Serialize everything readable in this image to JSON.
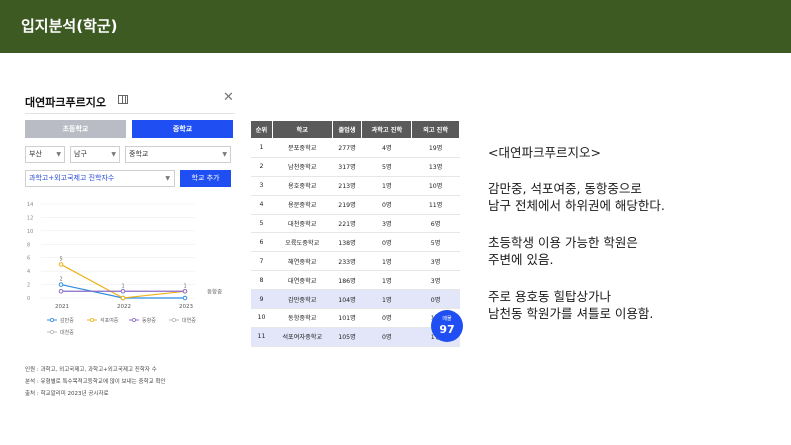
{
  "header": {
    "title": "입지분석(학군)"
  },
  "panel": {
    "title": "대연파크푸르지오",
    "tabs": [
      "초등학교",
      "중학교"
    ],
    "selects": [
      "부산",
      "남구",
      "중학교"
    ],
    "condition": "과학고+외고국제고 진학자수",
    "add_button": "학교 추가",
    "notes": [
      "인원 : 과학고, 외고국제고, 과학고+외고국제고 진학자 수",
      "분석 : 유형별로 특수목적고등학교에 많이 보내는 중학교 확인",
      "출처 : 학교알리미 2023년 공시자료"
    ]
  },
  "chart_data": {
    "type": "line",
    "x": [
      "2021",
      "2022",
      "2023"
    ],
    "ylim": [
      0,
      14
    ],
    "yticks": [
      0,
      2,
      4,
      6,
      8,
      10,
      12,
      14
    ],
    "series": [
      {
        "name": "감만중",
        "values": [
          2,
          0,
          0
        ],
        "color": "#2f8de4"
      },
      {
        "name": "석포여중",
        "values": [
          5,
          0,
          1
        ],
        "color": "#f0b21a"
      },
      {
        "name": "동항중",
        "values": [
          1,
          1,
          1
        ],
        "color": "#8a6bc9"
      },
      {
        "name": "대연중",
        "values": [
          null,
          null,
          null
        ],
        "color": "#b9b9b9"
      },
      {
        "name": "대천중",
        "values": [
          null,
          null,
          null
        ],
        "color": "#b9b9b9"
      }
    ],
    "data_labels": {
      "2021": [
        "5",
        "2"
      ],
      "2022": [
        "1"
      ],
      "2023": [
        "1"
      ]
    },
    "end_label": "동항중"
  },
  "table": {
    "headers": [
      "순위",
      "학교",
      "졸업생",
      "과학고 진학",
      "외고 진학"
    ],
    "rows": [
      [
        "1",
        "분포중학교",
        "277명",
        "4명",
        "19명"
      ],
      [
        "2",
        "남천중학교",
        "317명",
        "5명",
        "13명"
      ],
      [
        "3",
        "용호중학교",
        "213명",
        "1명",
        "10명"
      ],
      [
        "4",
        "용문중학교",
        "219명",
        "0명",
        "11명"
      ],
      [
        "5",
        "대천중학교",
        "221명",
        "3명",
        "6명"
      ],
      [
        "6",
        "오륙도중학교",
        "138명",
        "0명",
        "5명"
      ],
      [
        "7",
        "해연중학교",
        "233명",
        "1명",
        "3명"
      ],
      [
        "8",
        "대연중학교",
        "186명",
        "1명",
        "3명"
      ],
      [
        "9",
        "감만중학교",
        "104명",
        "1명",
        "0명"
      ],
      [
        "10",
        "동항중학교",
        "101명",
        "0명",
        "1명"
      ],
      [
        "11",
        "석포여자중학교",
        "105명",
        "0명",
        "1명"
      ]
    ],
    "highlighted_rows": [
      9,
      11
    ]
  },
  "badge": {
    "label": "매물",
    "value": "97"
  },
  "commentary": {
    "heading": "<대연파크푸르지오>",
    "line1": "감만중, 석포여중, 동항중으로",
    "line2": "남구 전체에서 하위권에 해당한다.",
    "line3": "초등학생 이용 가능한 학원은",
    "line4": "주변에 있음.",
    "line5": "주로 용호동 힐탑상가나",
    "line6": "남천동 학원가를 셔틀로 이용함."
  }
}
